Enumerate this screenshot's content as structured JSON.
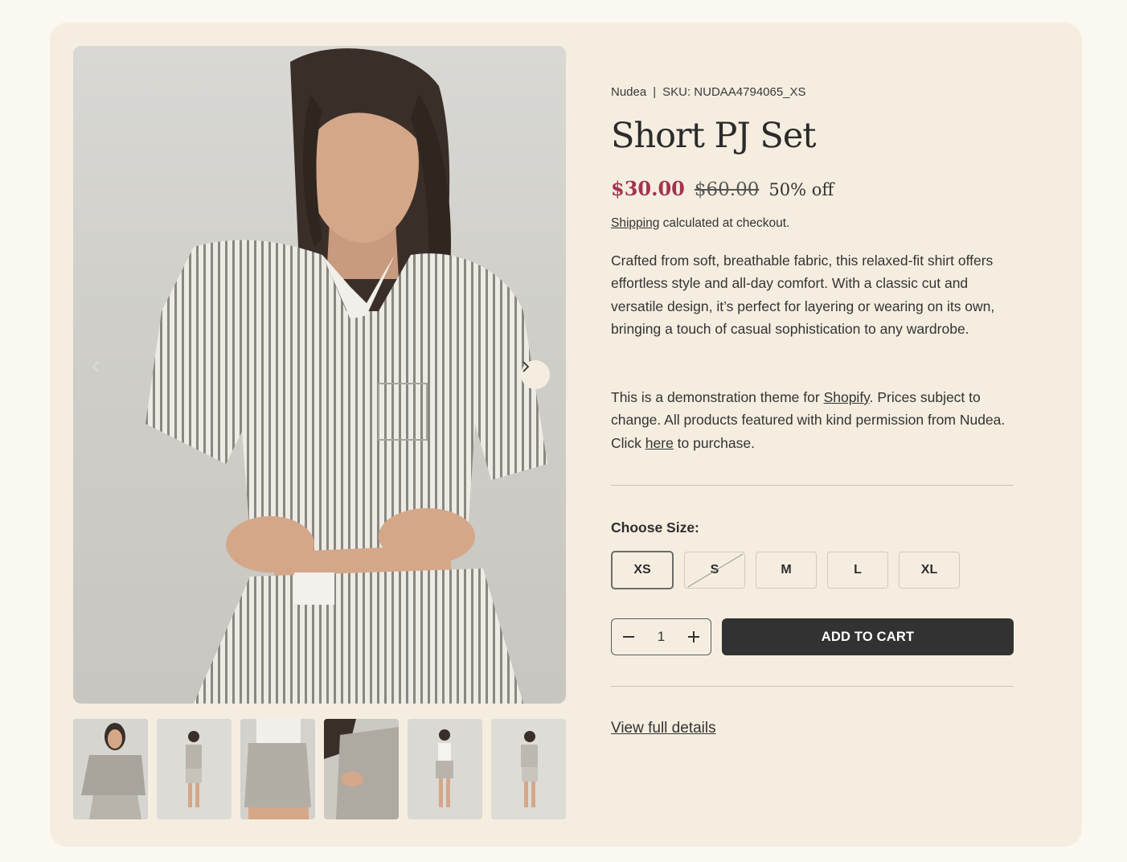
{
  "product": {
    "vendor": "Nudea",
    "separator": "|",
    "sku_label": "SKU: NUDAA4794065_XS",
    "title": "Short PJ Set",
    "price_sale": "$30.00",
    "price_original": "$60.00",
    "discount": "50% off",
    "shipping_link": "Shipping",
    "shipping_rest": " calculated at checkout.",
    "description": "Crafted from soft, breathable fabric, this relaxed-fit shirt offers effortless style and all-day comfort. With a classic cut and versatile design, it’s perfect for layering or wearing on its own, bringing a touch of casual sophistication to any wardrobe.",
    "demo_1": "This is a demonstration theme for ",
    "demo_link_shopify": "Shopify",
    "demo_2": ". Prices subject to change. All products featured with kind permission from Nudea. Click ",
    "demo_link_here": "here",
    "demo_3": " to purchase.",
    "colors": {
      "sale": "#a53250",
      "button": "#323232",
      "card": "#f5eee0"
    }
  },
  "size_selector": {
    "label": "Choose Size:",
    "options": [
      {
        "label": "XS",
        "state": "selected"
      },
      {
        "label": "S",
        "state": "unavailable"
      },
      {
        "label": "M",
        "state": "available"
      },
      {
        "label": "L",
        "state": "available"
      },
      {
        "label": "XL",
        "state": "available"
      }
    ]
  },
  "cart": {
    "quantity": "1",
    "minus_icon": "minus-icon",
    "plus_icon": "plus-icon",
    "add_label": "ADD TO CART"
  },
  "gallery": {
    "next_icon": "chevron-right-icon",
    "prev_icon": "chevron-left-icon",
    "thumbnail_count": 6,
    "active_thumbnail": 1
  },
  "links": {
    "full_details": "View full details"
  }
}
